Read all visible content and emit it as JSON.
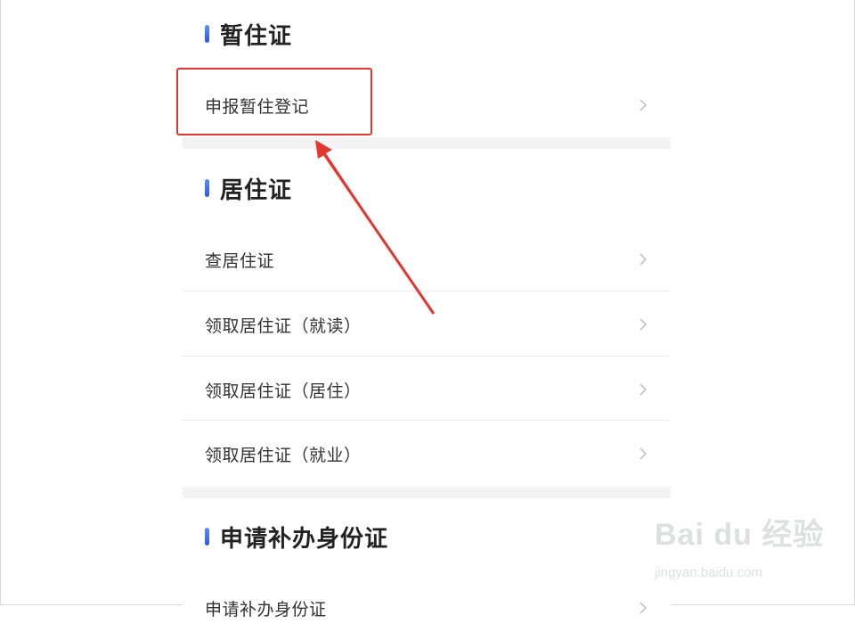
{
  "sections": [
    {
      "title": "暂住证",
      "items": [
        {
          "label": "申报暂住登记"
        }
      ]
    },
    {
      "title": "居住证",
      "items": [
        {
          "label": "查居住证"
        },
        {
          "label": "领取居住证（就读）"
        },
        {
          "label": "领取居住证（居住）"
        },
        {
          "label": "领取居住证（就业）"
        }
      ]
    },
    {
      "title": "申请补办身份证",
      "items": [
        {
          "label": "申请补办身份证"
        }
      ]
    }
  ],
  "annotation": {
    "color": "#e5352f"
  },
  "watermark": {
    "logo": "Bai du 经验",
    "url": "jingyan.baidu.com"
  },
  "colors": {
    "accent": "#2f54eb",
    "divider": "#ececec",
    "section_gap": "#f3f3f5"
  }
}
